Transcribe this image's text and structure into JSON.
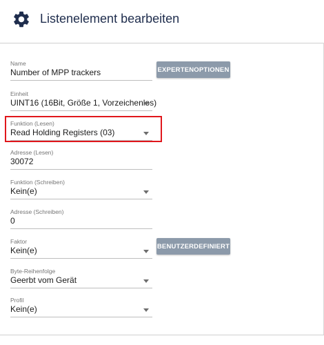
{
  "header": {
    "title": "Listenelement bearbeiten",
    "icon": "gear-icon"
  },
  "fields": [
    {
      "label": "Name",
      "value": "Number of MPP trackers"
    },
    {
      "label": "Einheit",
      "value": "UINT16 (16Bit, Größe 1, Vorzeichenlos)"
    },
    {
      "label": "Funktion (Lesen)",
      "value": "Read Holding Registers (03)"
    },
    {
      "label": "Adresse (Lesen)",
      "value": "30072"
    },
    {
      "label": "Funktion (Schreiben)",
      "value": "Kein(e)"
    },
    {
      "label": "Adresse (Schreiben)",
      "value": "0"
    },
    {
      "label": "Faktor",
      "value": "Kein(e)"
    },
    {
      "label": "Byte-Reihenfolge",
      "value": "Geerbt vom Gerät"
    },
    {
      "label": "Profil",
      "value": "Kein(e)"
    }
  ],
  "buttons": {
    "expert": "EXPERTENOPTIONEN",
    "custom": "BENUTZERDEFINIERT"
  },
  "colors": {
    "highlight": "#e0161b",
    "button": "#8c9aaa",
    "title": "#1f2d4d"
  }
}
